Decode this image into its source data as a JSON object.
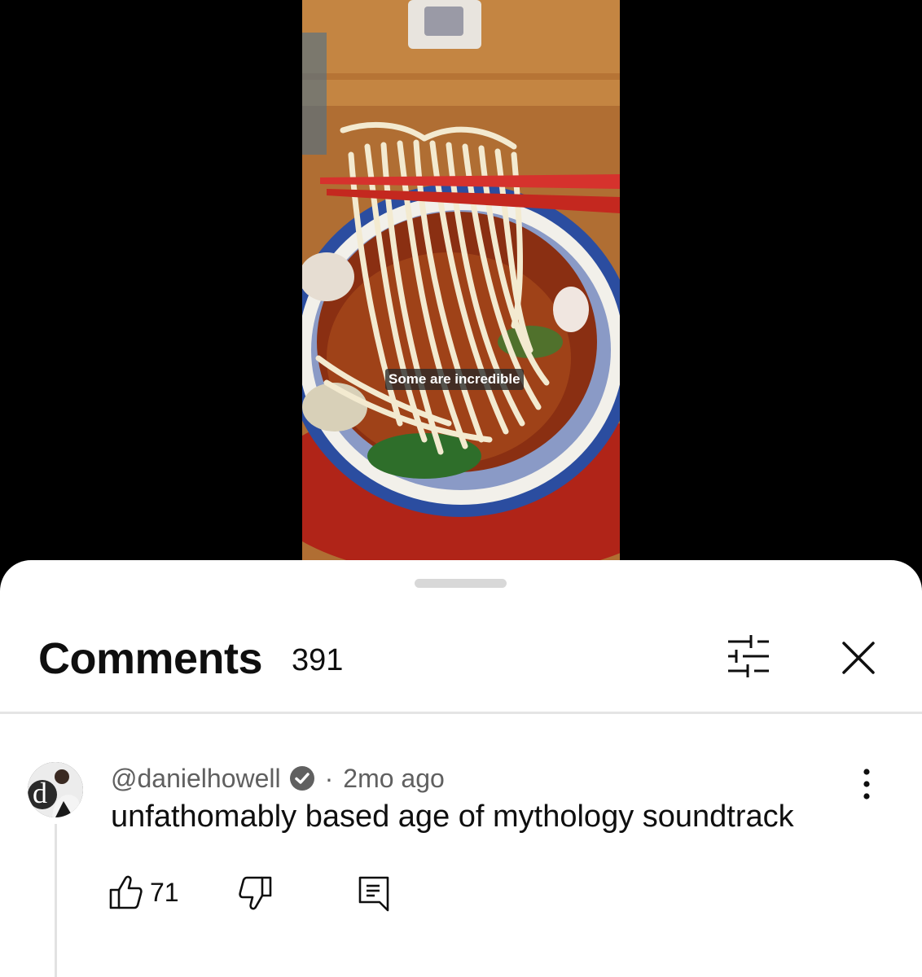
{
  "video": {
    "caption": "Some are incredible"
  },
  "comments_panel": {
    "title": "Comments",
    "count": "391",
    "filter_icon": "sliders-icon",
    "close_icon": "close-icon"
  },
  "comment": {
    "author": "@danielhowell",
    "verified_icon": "verified-checkmark-icon",
    "separator": "·",
    "time": "2mo ago",
    "text": "unfathomably based age of mythology soundtrack",
    "like_count": "71",
    "like_icon": "thumbs-up-icon",
    "dislike_icon": "thumbs-down-icon",
    "reply_icon": "reply-comment-icon",
    "more_icon": "more-vertical-icon"
  },
  "colors": {
    "background_sheet": "#ffffff",
    "text_primary": "#0f0f0f",
    "text_secondary": "#606060",
    "chopsticks": "#d6322d"
  }
}
